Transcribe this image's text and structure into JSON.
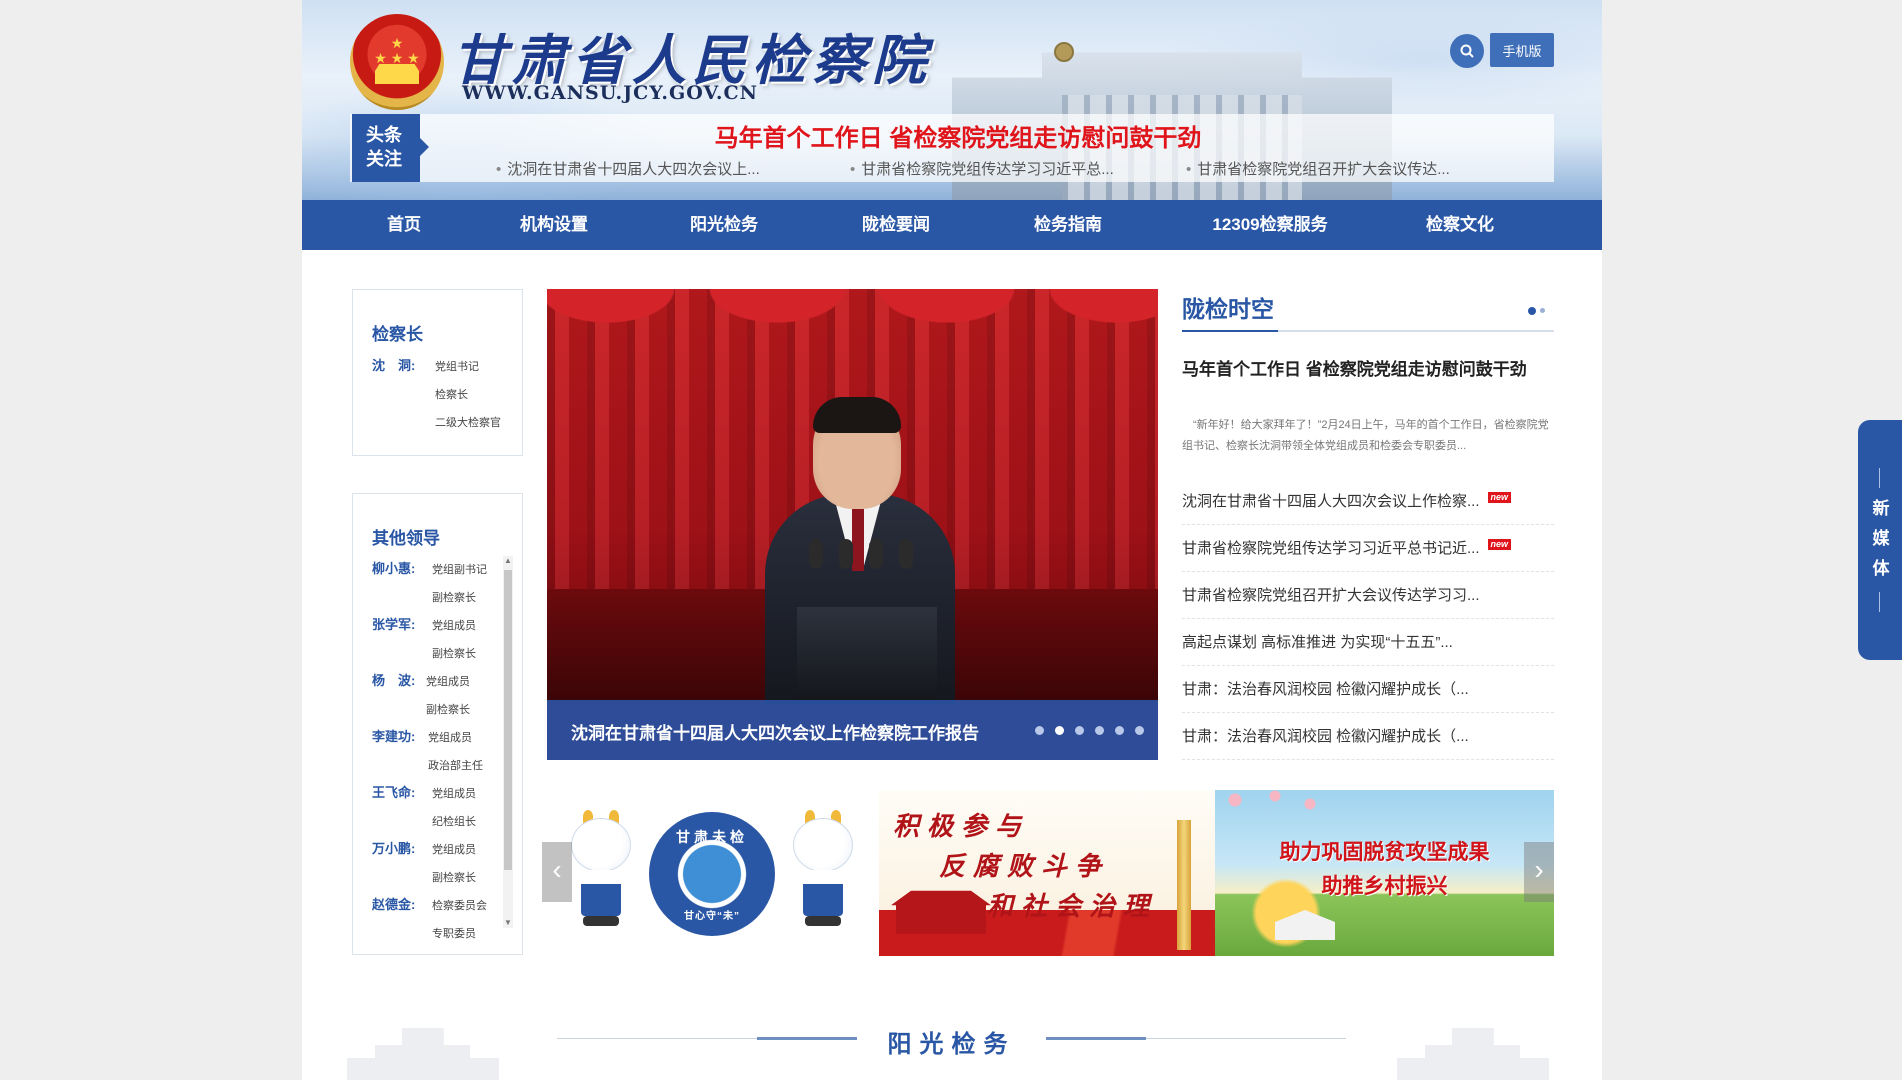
{
  "header": {
    "title": "甘肃省人民检察院",
    "url": "WWW.GANSU.JCY.GOV.CN",
    "mobile_label": "手机版",
    "headline_tag": "头条关注",
    "headline_tag_line1": "头条",
    "headline_tag_line2": "关注",
    "headline_main": "马年首个工作日 省检察院党组走访慰问鼓干劲",
    "headline_subs": [
      "沈洞在甘肃省十四届人大四次会议上...",
      "甘肃省检察院党组传达学习习近平总...",
      "甘肃省检察院党组召开扩大会议传达..."
    ]
  },
  "nav": {
    "items": [
      "首页",
      "机构设置",
      "阳光检务",
      "陇检要闻",
      "检务指南",
      "12309检察服务",
      "检察文化"
    ]
  },
  "chief_panel": {
    "title": "检察长",
    "name": "沈　洞:",
    "roles": [
      "党组书记",
      "检察长",
      "二级大检察官"
    ]
  },
  "other_leaders": {
    "title": "其他领导",
    "leaders": [
      {
        "name": "柳小惠:",
        "roles": [
          "党组副书记",
          "副检察长"
        ]
      },
      {
        "name": "张学军:",
        "roles": [
          "党组成员",
          "副检察长"
        ]
      },
      {
        "name": "杨　波:",
        "roles": [
          "党组成员",
          "副检察长"
        ]
      },
      {
        "name": "李建功:",
        "roles": [
          "党组成员",
          "政治部主任"
        ]
      },
      {
        "name": "王飞命:",
        "roles": [
          "党组成员",
          "纪检组长"
        ]
      },
      {
        "name": "万小鹏:",
        "roles": [
          "党组成员",
          "副检察长"
        ]
      },
      {
        "name": "赵德金:",
        "roles": [
          "检察委员会",
          "专职委员"
        ]
      }
    ]
  },
  "carousel": {
    "caption": "沈洞在甘肃省十四届人大四次会议上作检察院工作报告",
    "slide_count": 6,
    "active_slide": 2
  },
  "news": {
    "title": "陇检时空",
    "featured_title": "马年首个工作日 省检察院党组走访慰问鼓干劲",
    "featured_summary": "“新年好！给大家拜年了！”2月24日上午，马年的首个工作日，省检察院党组书记、检察长沈洞带领全体党组成员和检委会专职委员...",
    "new_badge": "new",
    "items": [
      {
        "text": "沈洞在甘肃省十四届人大四次会议上作检察...",
        "is_new": true
      },
      {
        "text": "甘肃省检察院党组传达学习习近平总书记近...",
        "is_new": true
      },
      {
        "text": "甘肃省检察院党组召开扩大会议传达学习习...",
        "is_new": false
      },
      {
        "text": "高起点谋划 高标准推进 为实现“十五五”...",
        "is_new": false
      },
      {
        "text": "甘肃：法治春风润校园 检徽闪耀护成长（...",
        "is_new": false
      },
      {
        "text": "甘肃：法治春风润校园 检徽闪耀护成长（...",
        "is_new": false
      }
    ]
  },
  "banners": {
    "mascot_badge_top": "甘肃未检",
    "mascot_badge_bottom": "甘心守“未”",
    "anticorruption_lines": [
      "积极参与",
      "反腐败斗争",
      "和社会治理"
    ],
    "poverty_lines": [
      "助力巩固脱贫攻坚成果",
      "助推乡村振兴"
    ]
  },
  "section": {
    "title": "阳光检务"
  },
  "new_media": {
    "label": "新媒体",
    "chars": [
      "新",
      "媒",
      "体"
    ]
  },
  "colors": {
    "primary_blue": "#2a57a5",
    "headline_red": "#e0141b",
    "page_bg": "#eeeeef"
  },
  "icons": {
    "search": "search-icon",
    "emblem": "national-emblem-icon",
    "prev": "chevron-left-icon",
    "next": "chevron-right-icon"
  }
}
